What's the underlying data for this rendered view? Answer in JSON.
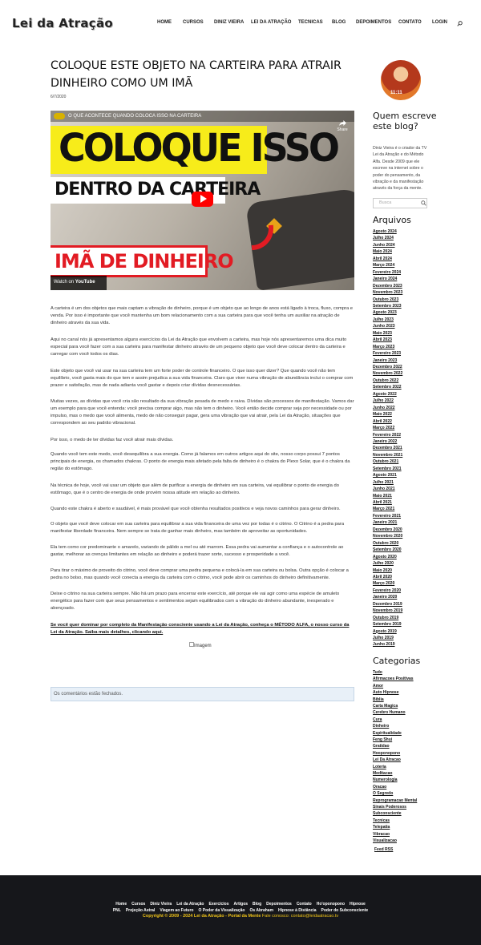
{
  "header": {
    "logo": "Lei da Atração",
    "nav": [
      "HOME",
      "CURSOS",
      "DINIZ VIEIRA",
      "LEI DA ATRAÇÃO",
      "TECNICAS",
      "BLOG",
      "DEPOIMENTOS",
      "CONTATO",
      "LOGIN"
    ],
    "search_icon": "search-icon"
  },
  "post": {
    "title": "COLOQUE ESTE OBJETO NA CARTEIRA PARA ATRAIR DINHEIRO COMO UM IMÃ",
    "date": "6/7/2020",
    "video": {
      "title": "O QUE ACONTECE QUANDO COLOCA ISSO NA CARTEIRA",
      "share": "Share",
      "line1": "COLOQUE ISSO",
      "line2": "DENTRO DA CARTEIRA",
      "line3": "IMÃ DE DINHEIRO",
      "watch_on": "Watch on",
      "youtube": "YouTube"
    },
    "paragraphs": [
      "A carteira é um dos objetos que mais captam a vibração de dinheiro, porque é um objeto que ao longo de anos está ligado à troca, fluxo, compra e venda. Por isso é importante que você mantenha um bom relacionamento com a sua carteira para que você tenha um auxiliar na atração de dinheiro através da sua vida.",
      "Aqui no canal nós já apresentamos alguns exercícios da Lei da Atração que envolvem a carteira, mas hoje nós apresentaremos uma dica muito especial para você fazer com a sua carteira para manifestar dinheiro através de um pequeno objeto que você deve colocar dentro da carteira e carregar com você todos os dias.",
      "Este objeto que você vai usar na sua carteira tem um forte poder de controle financeiro. O que isso quer dizer? Que quando você não tem equilíbrio, você gasta mais do que tem e assim prejudica a sua vida financeira. Claro que viver numa vibração de abundância inclui o comprar com prazer e satisfação, mas de nada adianta você gastar e depois criar dívidas desnecessárias.",
      "Muitas vezes, as dívidas que você cria são resultado da sua vibração pesada de medo e raiva. Dívidas são processos de manifestação. Vamos dar um exemplo para que você entenda: você precisa comprar algo, mas não tem o dinheiro. Você então decide comprar seja por necessidade ou por impulso, mas o medo que você alimenta, medo de não conseguir pagar, gera uma vibração que vai atrair, pela Lei da Atração, situações que correspondem ao seu padrão vibracional.",
      "Por isso, o medo de ter dívidas faz você atrair mais dívidas.",
      "Quando você tem este medo, você desequilibra a sua energia. Como já falamos em outros artigos aqui do site, nosso corpo possui 7 pontos principais de energia, os chamados chakras. O ponto de energia mais afetado pela falta de dinheiro é o chakra do Plexo Solar, que é o chakra da região do estômago.",
      "Na técnica de hoje, você vai usar um objeto que além de purificar a energia de dinheiro em sua carteira, vai equilibrar o ponto de energia do estômago, que é o centro de energia de onde provém nossa atitude em relação ao dinheiro.",
      "Quando este chakra é aberto e saudável, é mais provável que você obtenha resultados positivos e veja novos caminhos para gerar dinheiro.",
      "O objeto que você deve colocar em sua carteira para equilibrar a sua vida financeira de uma vez por todas é o citrino. O Citrino é a pedra para manifestar liberdade financeira. Nem sempre se trata de ganhar mais dinheiro, mas também de aproveitar as oportunidades.",
      "Ela tem como cor predominante o amarelo, variando de pálido a mel ou até marrom. Essa pedra vai aumentar a confiança e o autocontrole ao gastar, melhorar as crenças limitantes em relação ao dinheiro e poderá trazer sorte, sucesso e prosperidade a você.",
      "Para tirar o máximo de proveito do citrino, você deve comprar uma pedra pequena e colocá-la em sua carteira ou bolsa. Outra opção é colocar a pedra no bolso, mas quando você conecta a energia da carteira com o citrino, você pode abrir os caminhos do dinheiro definitivamente.",
      "Deixe o citrino na sua carteira sempre. Não há um prazo para encerrar este exercício, até porque ele vai agir como uma espécie de amuleto energético para fazer com que seus pensamentos e sentimentos sejam equilibrados com a vibração do dinheiro abundante, inesperado e abençoado."
    ],
    "cta": "Se você quer dominar por completo da Manifestação consciente usando a Lei da Atração, conheça o MÉTODO ALFA, o nosso curso da Lei da Atração. Saiba mais detalhes, clicando aqui.",
    "image_alt": "Imagem",
    "comments_closed": "Os comentários estão fechados."
  },
  "sidebar": {
    "avatar_text": "11:11",
    "who_title": "Quem escreve este blog?",
    "bio": "Diniz Vieira é o criador da TV Lei da Atração e do Método Alfa. Desde 2009 que ele escreve na internet sobre o poder do pensamento, da vibração e da manifestação através da força da mente.",
    "search_placeholder": "Busca",
    "archives_title": "Arquivos",
    "archives": [
      "Agosto 2024",
      "Julho 2024",
      "Junho 2024",
      "Maio 2024",
      "Abril 2024",
      "Março 2024",
      "Fevereiro 2024",
      "Janeiro 2024",
      "Dezembro 2023",
      "Novembro 2023",
      "Outubro 2023",
      "Setembro 2023",
      "Agosto 2023",
      "Julho 2023",
      "Junho 2023",
      "Maio 2023",
      "Abril 2023",
      "Março 2023",
      "Fevereiro 2023",
      "Janeiro 2023",
      "Dezembro 2022",
      "Novembro 2022",
      "Outubro 2022",
      "Setembro 2022",
      "Agosto 2022",
      "Julho 2022",
      "Junho 2022",
      "Maio 2022",
      "Abril 2022",
      "Março 2022",
      "Fevereiro 2022",
      "Janeiro 2022",
      "Dezembro 2021",
      "Novembro 2021",
      "Outubro 2021",
      "Setembro 2021",
      "Agosto 2021",
      "Julho 2021",
      "Junho 2021",
      "Maio 2021",
      "Abril 2021",
      "Março 2021",
      "Fevereiro 2021",
      "Janeiro 2021",
      "Dezembro 2020",
      "Novembro 2020",
      "Outubro 2020",
      "Setembro 2020",
      "Agosto 2020",
      "Julho 2020",
      "Maio 2020",
      "Abril 2020",
      "Março 2020",
      "Fevereiro 2020",
      "Janeiro 2020",
      "Dezembro 2019",
      "Novembro 2019",
      "Outubro 2019",
      "Setembro 2019",
      "Agosto 2019",
      "Julho 2019",
      "Junho 2019"
    ],
    "categories_title": "Categorias",
    "categories": [
      "Tudo",
      "Afirmacoes Positivas",
      "Amor",
      "Auto Hipnose",
      "Bíblia",
      "Carta Magica",
      "Cerebro Humano",
      "Cura",
      "Dinheiro",
      "Espiritualidade",
      "Feng Shui",
      "Gratidao",
      "Hooponopono",
      "Lei Da Atracao",
      "Loteria",
      "Meditacao",
      "Numerologia",
      "Oracao",
      "O Segredo",
      "Reprogramacao Mental",
      "Sinais Poderosos",
      "Subconsciente",
      "Tecnicas",
      "Telepatia",
      "Vibracao",
      "Visualizacao"
    ],
    "feed": "Feed RSS"
  },
  "footer": {
    "row1": [
      "Home",
      "Cursos",
      "Diniz Vieira",
      "Lei da Atração",
      "Exercícios",
      "Artigos",
      "Blog",
      "Depoimentos",
      "Contato",
      "Ho'oponopono",
      "Hipnose"
    ],
    "row2": [
      "PNL",
      "Projeção Astral",
      "Viagem ao Futuro",
      "O Poder da Visualização",
      "Os Abraham",
      "Hipnose à Distância",
      "Poder do Subconsciente"
    ],
    "copyright": "Copyright © 2009 - 2024 Lei da Atração - Portal da Mente",
    "contact": " Fale conosco: contato@leidaatracao.tv"
  }
}
